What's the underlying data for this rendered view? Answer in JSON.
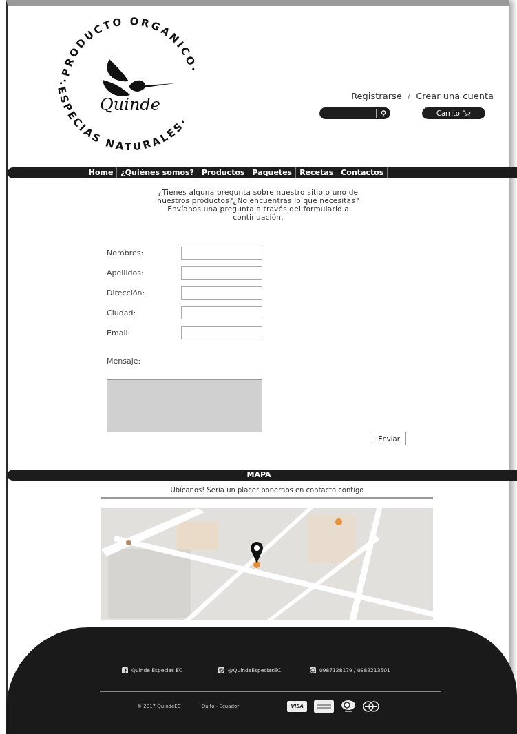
{
  "logo": {
    "top_text": "·PRODUCTO ORGANICO·",
    "bottom_text": "·ESPECIAS NATURALES·",
    "name": "Quinde"
  },
  "account": {
    "register": "Registrarse",
    "separator": "/",
    "create": "Crear una cuenta"
  },
  "cart": {
    "label": "Carrito"
  },
  "nav": [
    {
      "label": "Home",
      "selected": false
    },
    {
      "label": "¿Quiénes somos?",
      "selected": false
    },
    {
      "label": "Productos",
      "selected": false
    },
    {
      "label": "Paquetes",
      "selected": false
    },
    {
      "label": "Recetas",
      "selected": false
    },
    {
      "label": "Contactos",
      "selected": true
    }
  ],
  "intro": "¿Tienes alguna pregunta sobre nuestro sitio o uno de nuestros productos?¿No encuentras lo que necesitas? Envíanos una pregunta a través del formulario a continuación.",
  "form": {
    "fields": [
      {
        "label": "Nombres:"
      },
      {
        "label": "Apellidos:"
      },
      {
        "label": "Dirección:"
      },
      {
        "label": "Ciudad:"
      },
      {
        "label": "Email:"
      }
    ],
    "message_label": "Mensaje:",
    "submit": "Enviar"
  },
  "map_section": {
    "title": "MAPA",
    "subtitle": "Ubícanos! Sería un placer ponernos en contacto contigo"
  },
  "footer": {
    "social": [
      {
        "kind": "facebook",
        "label": "Quinde Especias EC"
      },
      {
        "kind": "instagram",
        "label": "@QuindeEspeciasEC"
      },
      {
        "kind": "whatsapp",
        "label": "0987128179 / 0982213501"
      }
    ],
    "copyright": "© 2017 QuindeEC",
    "location": "Quito - Ecuador",
    "cards": [
      {
        "kind": "visa",
        "label": "VISA"
      },
      {
        "kind": "amex"
      },
      {
        "kind": "diners"
      },
      {
        "kind": "mastercard"
      }
    ]
  }
}
